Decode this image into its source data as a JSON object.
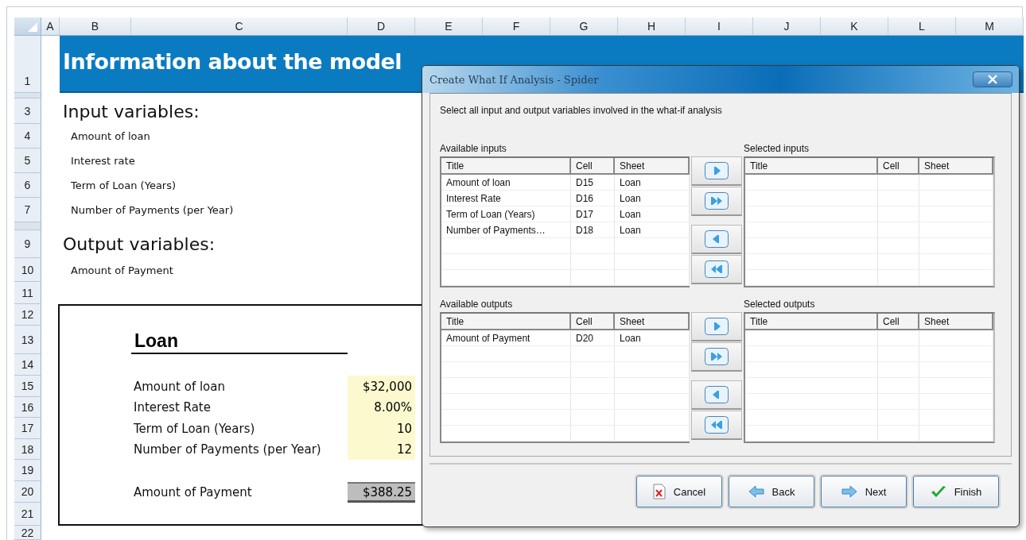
{
  "spreadsheet": {
    "columns": [
      "A",
      "B",
      "C",
      "D",
      "E",
      "F",
      "G",
      "H",
      "I",
      "J",
      "K",
      "L",
      "M"
    ],
    "row_numbers": [
      "1",
      "3",
      "4",
      "5",
      "6",
      "7",
      "9",
      "10",
      "11",
      "12",
      "13",
      "14",
      "15",
      "16",
      "17",
      "18",
      "19",
      "20",
      "21",
      "22"
    ],
    "banner_title": "Information about the model",
    "input_heading": "Input variables:",
    "input_variables": [
      "Amount of loan",
      "Interest rate",
      "Term of Loan (Years)",
      "Number of Payments (per Year)"
    ],
    "output_heading": "Output variables:",
    "output_variables": [
      "Amount of Payment"
    ],
    "loan": {
      "title": "Loan",
      "inputs": [
        {
          "label": "Amount of loan",
          "value": "$32,000"
        },
        {
          "label": "Interest Rate",
          "value": "8.00%"
        },
        {
          "label": "Term of Loan (Years)",
          "value": "10"
        },
        {
          "label": "Number of Payments (per Year)",
          "value": "12"
        }
      ],
      "output": {
        "label": "Amount of Payment",
        "value": "$388.25"
      }
    }
  },
  "dialog": {
    "title": "Create What If Analysis - Spider",
    "instruction": "Select all input and output variables involved in the what-if analysis",
    "sections": [
      {
        "available": {
          "label": "Available inputs",
          "columns": [
            "Title",
            "Cell",
            "Sheet"
          ],
          "rows": [
            [
              "Amount of loan",
              "D15",
              "Loan"
            ],
            [
              "Interest Rate",
              "D16",
              "Loan"
            ],
            [
              "Term of Loan (Years)",
              "D17",
              "Loan"
            ],
            [
              "Number of Payments…",
              "D18",
              "Loan"
            ]
          ]
        },
        "selected": {
          "label": "Selected inputs",
          "columns": [
            "Title",
            "Cell",
            "Sheet"
          ]
        }
      },
      {
        "available": {
          "label": "Available outputs",
          "columns": [
            "Title",
            "Cell",
            "Sheet"
          ],
          "rows": [
            [
              "Amount of Payment",
              "D20",
              "Loan"
            ]
          ]
        },
        "selected": {
          "label": "Selected outputs",
          "columns": [
            "Title",
            "Cell",
            "Sheet"
          ]
        }
      }
    ],
    "buttons": [
      {
        "label": "Cancel",
        "kind": "cancel"
      },
      {
        "label": "Back",
        "kind": "back"
      },
      {
        "label": "Next",
        "kind": "next"
      },
      {
        "label": "Finish",
        "kind": "finish"
      }
    ]
  }
}
